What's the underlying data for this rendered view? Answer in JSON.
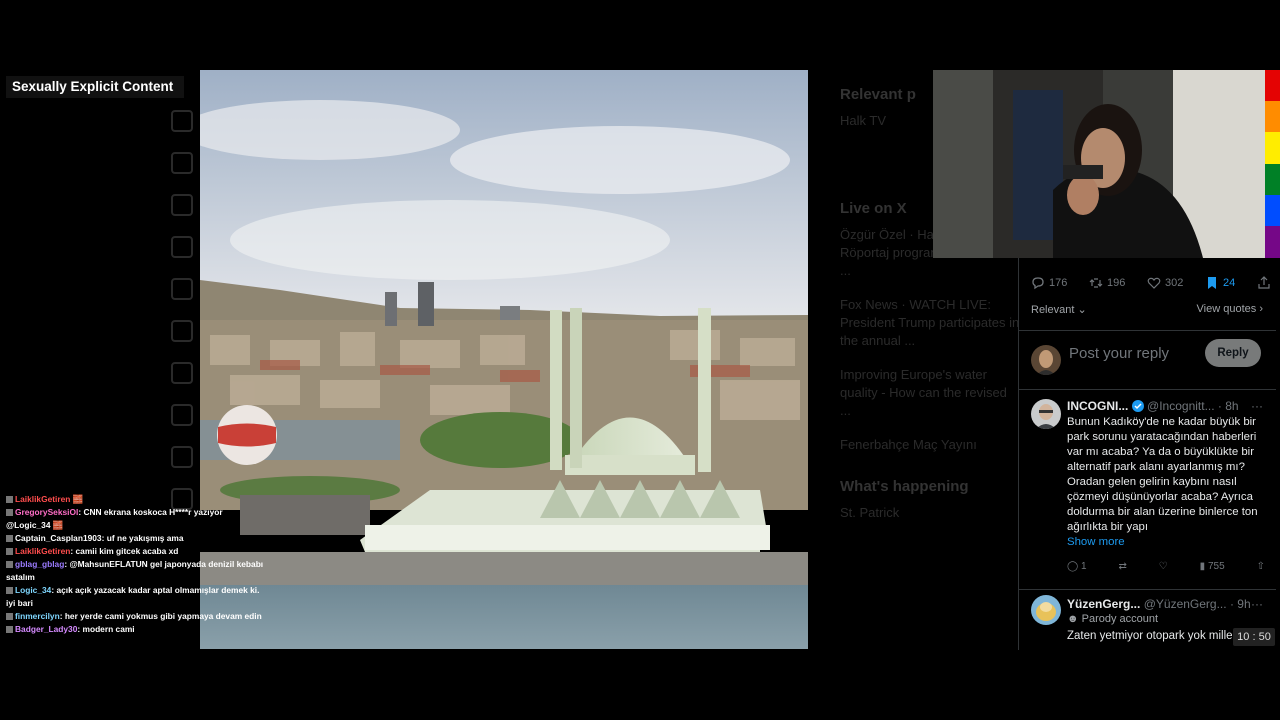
{
  "overlay_label": "Sexually Explicit Content",
  "chat": [
    {
      "user": "LaiklikGetiren",
      "user_color": "#ff4d4d",
      "text": "",
      "suffix": "🧱"
    },
    {
      "user": "GregorySeksiOl",
      "user_color": "#ff6ec7",
      "text": "CNN ekrana koskoca H****r yazıyor @Logic_34 🧱"
    },
    {
      "user": "Captain_Casplan1903",
      "user_color": "#ffffff",
      "text": "uf ne yakışmış ama"
    },
    {
      "user": "LaiklikGetiren",
      "user_color": "#ff4d4d",
      "text": "camii kim gitcek acaba xd"
    },
    {
      "user": "gblag_gblag",
      "user_color": "#9b7bff",
      "text": "@MahsunEFLATUN gel japonyada denizil kebabı satalım"
    },
    {
      "user": "Logic_34",
      "user_color": "#7fd7ff",
      "text": "açık açık yazacak kadar aptal olmamışlar demek ki. iyi bari"
    },
    {
      "user": "finmercilyn",
      "user_color": "#7fd7ff",
      "text": "her yerde cami yokmus gibi yapmaya devam edin"
    },
    {
      "user": "Badger_Lady30",
      "user_color": "#d58bff",
      "text": "modern cami"
    }
  ],
  "tweet_panel": {
    "actions": {
      "replies": "176",
      "reposts": "196",
      "likes": "302",
      "bookmarks": "24"
    },
    "sort_label": "Relevant",
    "view_quotes": "View quotes",
    "reply_placeholder": "Post your reply",
    "reply_button": "Reply",
    "reply1": {
      "name": "INCOGNI...",
      "handle": "@Incognitt...",
      "time": "· 8h",
      "body": "Bunun Kadıköy'de ne kadar büyük bir park sorunu yaratacağından haberleri var mı acaba? Ya da o büyüklükte bir alternatif park alanı ayarlanmış mı? Oradan gelen gelirin kaybını nasıl çözmeyi düşünüyorlar acaba? Ayrıca doldurma bir alan üzerine binlerce ton ağırlıkta bir yapı",
      "show_more": "Show more",
      "replies": "1",
      "views": "755"
    },
    "reply2": {
      "name": "YüzenGerg...",
      "handle": "@YüzenGerg...",
      "time": "· 9h",
      "parody": "Parody account",
      "body": "Zaten yetmiyor otopark yok mille"
    }
  },
  "background": {
    "blocks": [
      {
        "h": "Relevant p",
        "t": "Halk TV"
      },
      {
        "h": "Live on X",
        "t": "Özgür Özel · Halk TV'de Özel Röportaj programında sorulan ..."
      },
      {
        "h": "",
        "t": "Fox News · WATCH LIVE: President Trump participates in the annual ..."
      },
      {
        "h": "",
        "t": "Improving Europe's water quality - How can the revised ..."
      },
      {
        "h": "",
        "t": "Fenerbahçe Maç Yayını"
      },
      {
        "h": "What's happening",
        "t": "St. Patrick"
      }
    ]
  },
  "timer": "10 : 50"
}
